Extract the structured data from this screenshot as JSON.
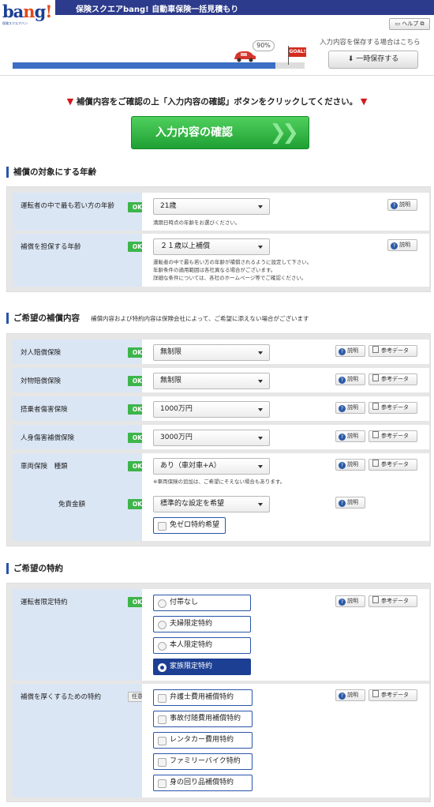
{
  "header": {
    "logo_text": "bang!",
    "logo_sub": "保険スクエアバン",
    "title": "保険スクエアbang! 自動車保険一括見積もり",
    "help_label": "ヘルプ"
  },
  "progress": {
    "percent_label": "90%",
    "percent": 90,
    "goal_label": "GOAL!",
    "save_hint": "入力内容を保存する場合はこちら",
    "save_button": "一時保存する"
  },
  "notice": "補償内容をご確認の上「入力内容の確認」ボタンをクリックしてください。",
  "confirm_button": "入力内容の確認",
  "common": {
    "ok": "OK",
    "optional": "任意",
    "explain": "説明",
    "reference": "参考データ"
  },
  "age_section": {
    "title": "補償の対象にする年齢",
    "youngest_label": "運転者の中で最も若い方の年齢",
    "youngest_value": "21歳",
    "youngest_note": "満期日時点の年齢をお選びください。",
    "age_cond_label": "補償を担保する年齢",
    "age_cond_value": "２１歳以上補償",
    "age_cond_note1": "運転者の中で最も若い方の年齢が補償されるように設定して下さい。",
    "age_cond_note2": "年齢条件の適用範囲は各社異なる場合がございます。",
    "age_cond_note3": "詳細な条件については、各社のホームページ等でご確認ください。"
  },
  "coverage_section": {
    "title": "ご希望の補償内容",
    "subtitle": "補償内容および特約内容は保険会社によって、ご希望に添えない場合がございます",
    "rows": [
      {
        "label": "対人賠償保険",
        "value": "無制限"
      },
      {
        "label": "対物賠償保険",
        "value": "無制限"
      },
      {
        "label": "搭乗者傷害保険",
        "value": "1000万円"
      },
      {
        "label": "人身傷害補償保険",
        "value": "3000万円"
      }
    ],
    "vehicle_label": "車両保険　種類",
    "vehicle_value": "あり（車対車+A）",
    "vehicle_note": "※車両保険の追加は、ご希望にそえない場合もあります。",
    "deductible_label": "免責金額",
    "deductible_value": "標準的な設定を希望",
    "zero_option": "免ゼロ特約希望"
  },
  "special_section": {
    "title": "ご希望の特約",
    "driver_label": "運転者限定特約",
    "driver_options": [
      "付帯なし",
      "夫婦限定特約",
      "本人限定特約",
      "家族限定特約"
    ],
    "driver_selected": "家族限定特約",
    "extra_label": "補償を厚くするための特約",
    "extra_options": [
      "弁護士費用補償特約",
      "事故付随費用補償特約",
      "レンタカー費用特約",
      "ファミリーバイク特約",
      "身の回り品補償特約"
    ]
  }
}
